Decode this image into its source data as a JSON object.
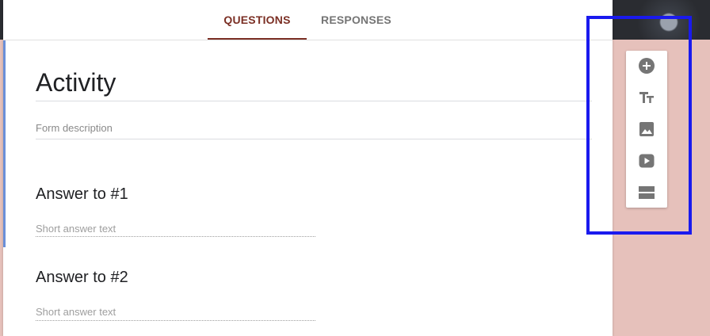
{
  "tabs": {
    "questions": "QUESTIONS",
    "responses": "RESPONSES",
    "active": "questions"
  },
  "form": {
    "title": "Activity",
    "description_placeholder": "Form description"
  },
  "questions": [
    {
      "title": "Answer to #1",
      "hint": "Short answer text"
    },
    {
      "title": "Answer to #2",
      "hint": "Short answer text"
    }
  ],
  "toolbar": {
    "tools": [
      "add-question-icon",
      "add-title-text-icon",
      "add-image-icon",
      "add-video-icon",
      "add-section-icon"
    ]
  },
  "colors": {
    "accent": "#7b2f24",
    "page_background": "#e6c1bb",
    "left_accent": "#6a8fd8",
    "icon_gray": "#757575",
    "highlight_box": "#1a1aee"
  }
}
